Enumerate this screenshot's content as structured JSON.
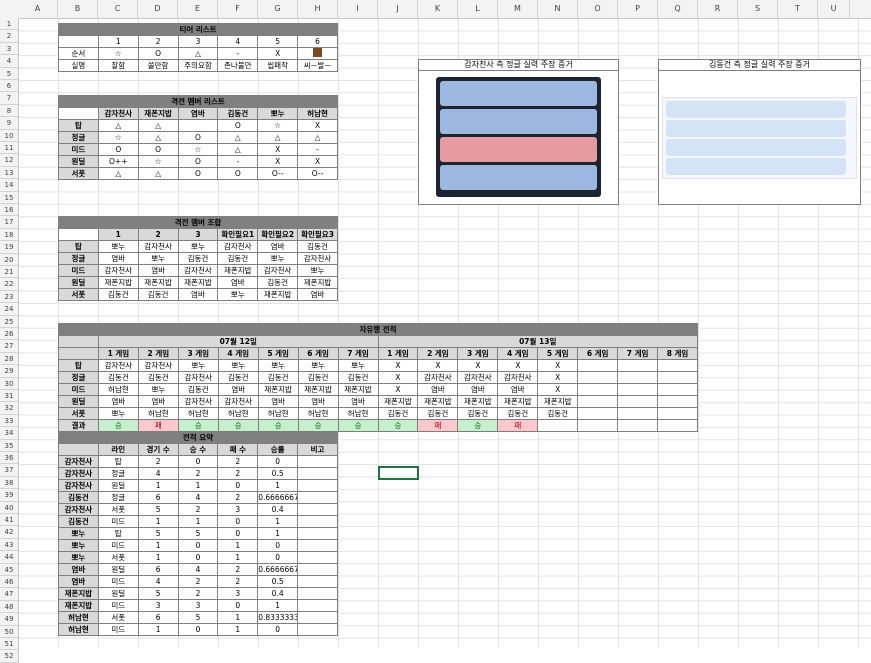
{
  "cols": [
    "A",
    "B",
    "C",
    "D",
    "E",
    "F",
    "G",
    "H",
    "I",
    "J",
    "K",
    "L",
    "M",
    "N",
    "O",
    "P",
    "Q",
    "R",
    "S",
    "T",
    "U"
  ],
  "rows": [
    "1",
    "2",
    "3",
    "4",
    "5",
    "6",
    "7",
    "8",
    "9",
    "10",
    "11",
    "12",
    "13",
    "14",
    "15",
    "16",
    "17",
    "18",
    "19",
    "20",
    "21",
    "22",
    "23",
    "24",
    "25",
    "26",
    "27",
    "28",
    "29",
    "30",
    "31",
    "32",
    "33",
    "34",
    "35",
    "36",
    "37",
    "38",
    "39",
    "40",
    "41",
    "42",
    "43",
    "44",
    "45",
    "46",
    "47",
    "48",
    "49",
    "50",
    "51",
    "52"
  ],
  "tier": {
    "title": "티어 리스트",
    "nums": [
      "1",
      "2",
      "3",
      "4",
      "5",
      "6"
    ],
    "order_label": "순서",
    "order": [
      "☆",
      "O",
      "△",
      "-",
      "X",
      ""
    ],
    "real_label": "실명",
    "real": [
      "잘함",
      "쓸만함",
      "주의요함",
      "존나불안",
      "씹패작",
      "씨ㅡ발ㅡ"
    ]
  },
  "member": {
    "title": "격전 멤버 리스트",
    "names": [
      "감자천사",
      "재폰지밥",
      "염바",
      "김동건",
      "뽀누",
      "허남현"
    ],
    "rows": [
      {
        "pos": "탑",
        "vals": [
          "△",
          "△",
          "",
          "O",
          "☆",
          "X"
        ]
      },
      {
        "pos": "정글",
        "vals": [
          "☆",
          "△",
          "O",
          "△",
          "△",
          "△"
        ]
      },
      {
        "pos": "미드",
        "vals": [
          "O",
          "O",
          "☆",
          "△",
          "X",
          "-"
        ]
      },
      {
        "pos": "원딜",
        "vals": [
          "O++",
          "☆",
          "O",
          "-",
          "X",
          "X"
        ]
      },
      {
        "pos": "서폿",
        "vals": [
          "△",
          "△",
          "O",
          "O",
          "O--",
          "O--"
        ]
      }
    ]
  },
  "combo": {
    "title": "격전 멤버 조합",
    "headers": [
      "1",
      "2",
      "3",
      "확인필요1",
      "확인필요2",
      "확인필요3"
    ],
    "rows": [
      {
        "pos": "탑",
        "vals": [
          "뽀누",
          "감자천사",
          "뽀누",
          "감자천사",
          "염바",
          "김동건"
        ]
      },
      {
        "pos": "정글",
        "vals": [
          "염바",
          "뽀누",
          "김동건",
          "김동건",
          "뽀누",
          "감자천사"
        ]
      },
      {
        "pos": "미드",
        "vals": [
          "감자천사",
          "염바",
          "감자천사",
          "재폰지밥",
          "감자천사",
          "뽀누"
        ]
      },
      {
        "pos": "원딜",
        "vals": [
          "재폰지밥",
          "재폰지밥",
          "재폰지밥",
          "염바",
          "김동건",
          "재폰지밥"
        ]
      },
      {
        "pos": "서폿",
        "vals": [
          "김동건",
          "김동건",
          "염바",
          "뽀누",
          "재폰지밥",
          "염바"
        ]
      }
    ]
  },
  "record": {
    "title": "자유랭 전적",
    "date1": "07월 12일",
    "date2": "07월 13일",
    "games1": [
      "1 게임",
      "2 게임",
      "3 게임",
      "4 게임",
      "5 게임",
      "6 게임",
      "7 게임"
    ],
    "games2": [
      "1 게임",
      "2 게임",
      "3 게임",
      "4 게임",
      "5 게임",
      "6 게임",
      "7 게임",
      "8 게임"
    ],
    "rows": [
      {
        "pos": "탑",
        "d1": [
          "감자천사",
          "감자천사",
          "뽀누",
          "뽀누",
          "뽀누",
          "뽀누",
          "뽀누"
        ],
        "d2": [
          "X",
          "X",
          "X",
          "X",
          "X",
          "",
          "",
          " "
        ]
      },
      {
        "pos": "정글",
        "d1": [
          "김동건",
          "김동건",
          "감자천사",
          "김동건",
          "김동건",
          "김동건",
          "김동건"
        ],
        "d2": [
          "X",
          "감자천사",
          "감자천사",
          "감자천사",
          "X",
          "",
          "",
          ""
        ]
      },
      {
        "pos": "미드",
        "d1": [
          "허남현",
          "뽀누",
          "김동건",
          "염바",
          "재폰지밥",
          "재폰지밥",
          "재폰지밥"
        ],
        "d2": [
          "X",
          "염바",
          "염바",
          "염바",
          "X",
          "",
          "",
          ""
        ]
      },
      {
        "pos": "원딜",
        "d1": [
          "염바",
          "염바",
          "감자천사",
          "감자천사",
          "염바",
          "염바",
          "염바"
        ],
        "d2": [
          "재폰지밥",
          "재폰지밥",
          "재폰지밥",
          "재폰지밥",
          "재폰지밥",
          "",
          "",
          ""
        ]
      },
      {
        "pos": "서폿",
        "d1": [
          "뽀누",
          "허남현",
          "허남현",
          "허남현",
          "허남현",
          "허남현",
          "허남현"
        ],
        "d2": [
          "김동건",
          "김동건",
          "김동건",
          "김동건",
          "김동건",
          "",
          "",
          ""
        ]
      }
    ],
    "result_label": "결과",
    "res1": [
      "승",
      "패",
      "승",
      "승",
      "승",
      "승",
      "승"
    ],
    "res2": [
      "승",
      "패",
      "승",
      "패",
      "",
      "",
      "",
      ""
    ]
  },
  "summary": {
    "title": "전적 요약",
    "headers": [
      "",
      "라인",
      "경기 수",
      "승 수",
      "패 수",
      "승률",
      "비고"
    ],
    "rows": [
      [
        "감자천사",
        "탑",
        "2",
        "0",
        "2",
        "0",
        ""
      ],
      [
        "감자천사",
        "정글",
        "4",
        "2",
        "2",
        "0.5",
        ""
      ],
      [
        "감자천사",
        "원딜",
        "1",
        "1",
        "0",
        "1",
        ""
      ],
      [
        "김동건",
        "정글",
        "6",
        "4",
        "2",
        "0.6666667",
        ""
      ],
      [
        "감자천사",
        "서폿",
        "5",
        "2",
        "3",
        "0.4",
        ""
      ],
      [
        "김동건",
        "미드",
        "1",
        "1",
        "0",
        "1",
        ""
      ],
      [
        "뽀누",
        "탑",
        "5",
        "5",
        "0",
        "1",
        ""
      ],
      [
        "뽀누",
        "미드",
        "1",
        "0",
        "1",
        "0",
        ""
      ],
      [
        "뽀누",
        "서폿",
        "1",
        "0",
        "1",
        "0",
        ""
      ],
      [
        "염바",
        "원딜",
        "6",
        "4",
        "2",
        "0.6666667",
        ""
      ],
      [
        "염바",
        "미드",
        "4",
        "2",
        "2",
        "0.5",
        ""
      ],
      [
        "재폰지밥",
        "원딜",
        "5",
        "2",
        "3",
        "0.4",
        ""
      ],
      [
        "재폰지밥",
        "미드",
        "3",
        "3",
        "0",
        "1",
        ""
      ],
      [
        "허남현",
        "서폿",
        "6",
        "5",
        "1",
        "0.8333333",
        ""
      ],
      [
        "허남현",
        "미드",
        "1",
        "0",
        "1",
        "0",
        ""
      ]
    ]
  },
  "evidence1": {
    "title": "감자천사 측 정글 실력 주장 증거"
  },
  "evidence2": {
    "title": "김동건 측 정글 실력 주장 증거"
  }
}
